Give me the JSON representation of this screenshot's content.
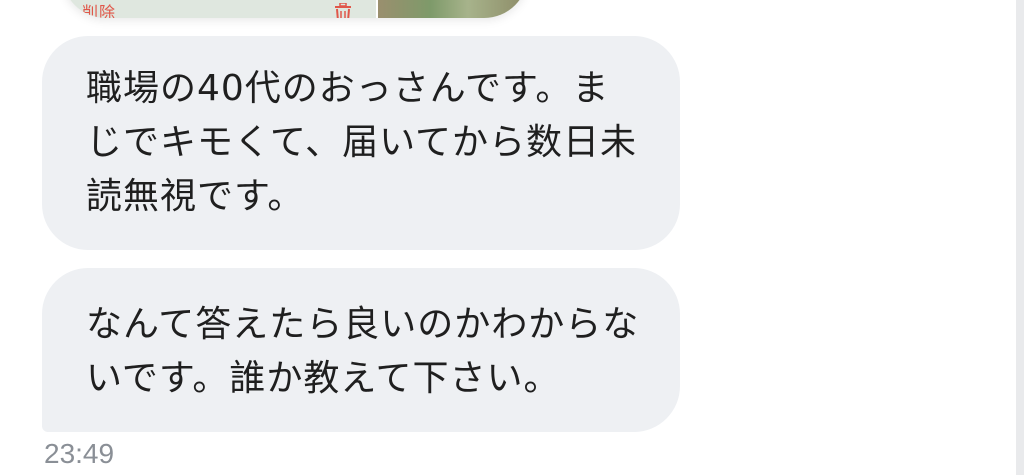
{
  "preview_card": {
    "delete_label": "削除",
    "trash_icon": "trash-icon"
  },
  "messages": [
    {
      "lines": [
        "職場の40代のおっさんです。ま",
        "じでキモくて、届いてから数日未",
        "読無視です。"
      ]
    },
    {
      "lines": [
        "なんて答えたら良いのかわからな",
        "いです。誰か教えて下さい。"
      ]
    }
  ],
  "timestamp": "23:49",
  "colors": {
    "bubble_bg": "#eef0f3",
    "text": "#1f1f1f",
    "timestamp": "#8a8f96",
    "delete_red": "#e0574a"
  }
}
